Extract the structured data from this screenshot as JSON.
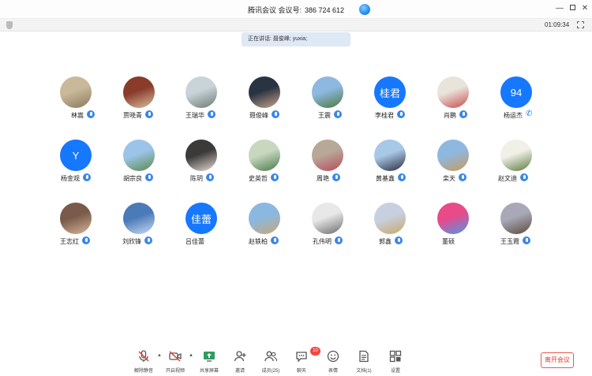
{
  "window": {
    "title": "腾讯会议",
    "meeting_label": "会议号:",
    "meeting_id": "386 724 612"
  },
  "timer": "01:09:34",
  "speaking": "正在讲话: 聂俊峰; yuxia;",
  "participants": [
    {
      "name": "林嵩",
      "avatar": {
        "type": "photo",
        "colors": [
          "#c9b99a",
          "#8a7a5c"
        ]
      },
      "status": "mic"
    },
    {
      "name": "贾晓青",
      "avatar": {
        "type": "photo",
        "colors": [
          "#8a3b2a",
          "#d8c0a0"
        ]
      },
      "status": "mic"
    },
    {
      "name": "王瑞华",
      "avatar": {
        "type": "photo",
        "colors": [
          "#c9d4d8",
          "#6c7a70"
        ]
      },
      "status": "mic"
    },
    {
      "name": "聂俊峰",
      "avatar": {
        "type": "photo",
        "colors": [
          "#2a3342",
          "#c9a68c"
        ]
      },
      "status": "mic"
    },
    {
      "name": "王震",
      "avatar": {
        "type": "photo",
        "colors": [
          "#8fb8e0",
          "#4a7a3a"
        ]
      },
      "status": "mic"
    },
    {
      "name": "李桂君",
      "avatar": {
        "type": "text",
        "text": "桂君"
      },
      "status": "mic"
    },
    {
      "name": "肖鹏",
      "avatar": {
        "type": "photo",
        "colors": [
          "#e8e4dc",
          "#c94a4a"
        ]
      },
      "status": "mic"
    },
    {
      "name": "杨运杰",
      "avatar": {
        "type": "text",
        "text": "94"
      },
      "status": "phone"
    },
    {
      "name": "杨金观",
      "avatar": {
        "type": "text",
        "text": "Y"
      },
      "status": "mic"
    },
    {
      "name": "胡宗良",
      "avatar": {
        "type": "photo",
        "colors": [
          "#9cc4e8",
          "#5a8a4a"
        ]
      },
      "status": "mic"
    },
    {
      "name": "陈玥",
      "avatar": {
        "type": "photo",
        "colors": [
          "#3a3a3a",
          "#e8dcd4"
        ]
      },
      "status": "mic"
    },
    {
      "name": "史英哲",
      "avatar": {
        "type": "photo",
        "colors": [
          "#c8d8c0",
          "#4a7a4a"
        ]
      },
      "status": "mic"
    },
    {
      "name": "周艳",
      "avatar": {
        "type": "photo",
        "colors": [
          "#b8a898",
          "#b84a5a"
        ]
      },
      "status": "mic"
    },
    {
      "name": "黄基鑫",
      "avatar": {
        "type": "photo",
        "colors": [
          "#a8c8e8",
          "#2a2a3a"
        ]
      },
      "status": "mic"
    },
    {
      "name": "栾天",
      "avatar": {
        "type": "photo",
        "colors": [
          "#8fb8e0",
          "#c89a5a"
        ]
      },
      "status": "mic"
    },
    {
      "name": "赵文迪",
      "avatar": {
        "type": "photo",
        "colors": [
          "#f0f0e8",
          "#5a7a3a"
        ]
      },
      "status": "mic"
    },
    {
      "name": "王志红",
      "avatar": {
        "type": "photo",
        "colors": [
          "#7a5a4a",
          "#d8b89a"
        ]
      },
      "status": "mic"
    },
    {
      "name": "刘欣锋",
      "avatar": {
        "type": "photo",
        "colors": [
          "#4a7ab8",
          "#c8dcf0"
        ]
      },
      "status": "mic"
    },
    {
      "name": "吕佳蕾",
      "avatar": {
        "type": "text",
        "text": "佳蕾"
      },
      "status": "none"
    },
    {
      "name": "赵轶柏",
      "avatar": {
        "type": "photo",
        "colors": [
          "#8ab8e0",
          "#c8a878"
        ]
      },
      "status": "mic"
    },
    {
      "name": "孔伟明",
      "avatar": {
        "type": "photo",
        "colors": [
          "#e8e8e8",
          "#6a6a6a"
        ]
      },
      "status": "mic"
    },
    {
      "name": "郭鑫",
      "avatar": {
        "type": "photo",
        "colors": [
          "#c8d0e0",
          "#c8a868"
        ]
      },
      "status": "mic"
    },
    {
      "name": "董硕",
      "avatar": {
        "type": "photo",
        "colors": [
          "#e84a8a",
          "#4a9ae8"
        ]
      },
      "status": "none"
    },
    {
      "name": "王玉霞",
      "avatar": {
        "type": "photo",
        "colors": [
          "#a8a8b8",
          "#5a4a3a"
        ]
      },
      "status": "mic"
    }
  ],
  "toolbar": {
    "items": [
      {
        "id": "unmute",
        "label": "解除静音",
        "icon": "mic-muted-icon"
      },
      {
        "id": "video",
        "label": "开启视频",
        "icon": "video-off-icon"
      },
      {
        "id": "share",
        "label": "共享屏幕",
        "icon": "screen-share-icon"
      },
      {
        "id": "invite",
        "label": "邀请",
        "icon": "add-person-icon"
      },
      {
        "id": "members",
        "label": "成员(25)",
        "icon": "members-icon"
      },
      {
        "id": "chat",
        "label": "聊天",
        "icon": "chat-icon",
        "badge": "10"
      },
      {
        "id": "emoji",
        "label": "表情",
        "icon": "emoji-icon"
      },
      {
        "id": "docs",
        "label": "文档(1)",
        "icon": "document-icon"
      },
      {
        "id": "apps",
        "label": "设置",
        "icon": "apps-icon"
      }
    ],
    "leave_label": "离开会议"
  },
  "colors": {
    "accent": "#1677ff",
    "danger": "#e23a2e"
  }
}
